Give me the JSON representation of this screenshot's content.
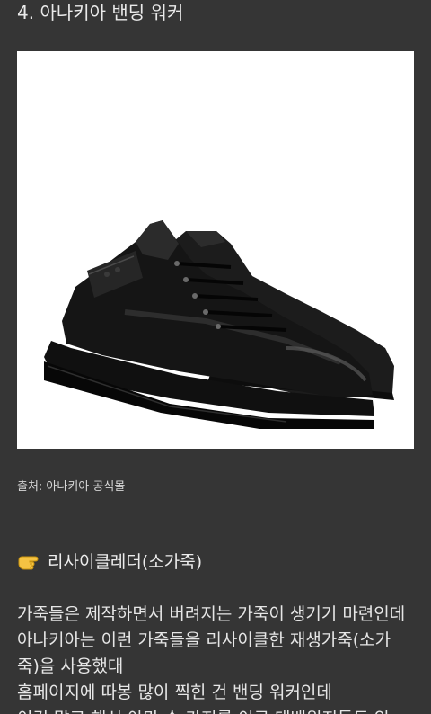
{
  "article": {
    "heading": "4. 아나키아 밴딩 워커",
    "image": {
      "alt": "아나키아 밴딩 워커 black leather walker shoes",
      "background": "#ffffff"
    },
    "caption": "출처: 아나키아 공식몰",
    "section_icon": "pointing-hand-icon",
    "section_title": "리사이클레더(소가죽)",
    "paragraph_lines": [
      "가죽들은 제작하면서 버려지는 가죽이 생기기 마련인데",
      "아나키아는 이런 가죽들을 리사이클한 재생가죽(소가",
      "죽)을 사용했대",
      "홈페이지에 따봉 많이 찍힌 건 밴딩 워커인데",
      "이건 많고 해서 아마 수 가지를 이로 대배워지들도 안"
    ]
  },
  "colors": {
    "background": "#353535",
    "text": "#e8e8e8"
  }
}
